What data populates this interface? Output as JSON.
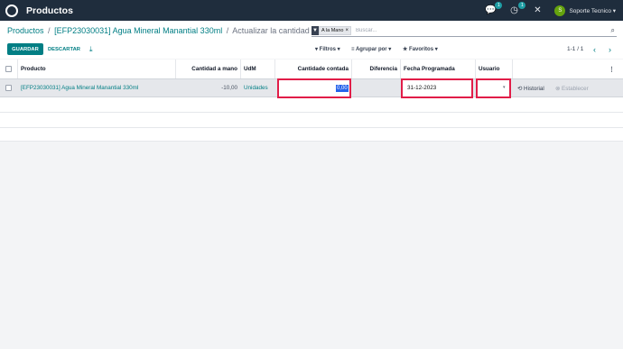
{
  "topbar": {
    "app_title": "Productos",
    "chat_badge": "1",
    "activity_badge": "1",
    "avatar_initial": "S",
    "user_name": "Soporte Tecnico ▾"
  },
  "breadcrumb": {
    "root": "Productos",
    "product": "[EFP23030031] Agua Mineral Manantial 330ml",
    "current": "Actualizar la cantidad",
    "separator": "/"
  },
  "search": {
    "facet_label": "A la Mano",
    "facet_remove": "×",
    "placeholder": "Buscar..."
  },
  "buttons": {
    "save": "GUARDAR",
    "discard": "DESCARTAR"
  },
  "filters": {
    "filtros": "▾ Filtros ▾",
    "agrupar": "≡ Agrupar por ▾",
    "favoritos": "★ Favoritos ▾"
  },
  "pager": {
    "value": "1-1 / 1",
    "prev": "‹",
    "next": "›"
  },
  "table": {
    "columns": [
      "Producto",
      "Cantidad a mano",
      "UdM",
      "Cantidade contada",
      "Diferencia",
      "Fecha Programada",
      "Usuario"
    ],
    "rows": [
      {
        "producto": "[EFP23030031] Agua Mineral Manantial 330ml",
        "cantidad_a_mano": "-10,00",
        "udm": "Unidades",
        "cantidad_contada": "0,00",
        "diferencia": "",
        "fecha_programada": "31-12-2023",
        "usuario": "",
        "action_history": "⟲ Historial",
        "action_set": "⊗ Establecer"
      }
    ]
  },
  "colors": {
    "topbar": "#1f2d3d",
    "accent": "#017e84",
    "highlight": "#e11d48"
  }
}
